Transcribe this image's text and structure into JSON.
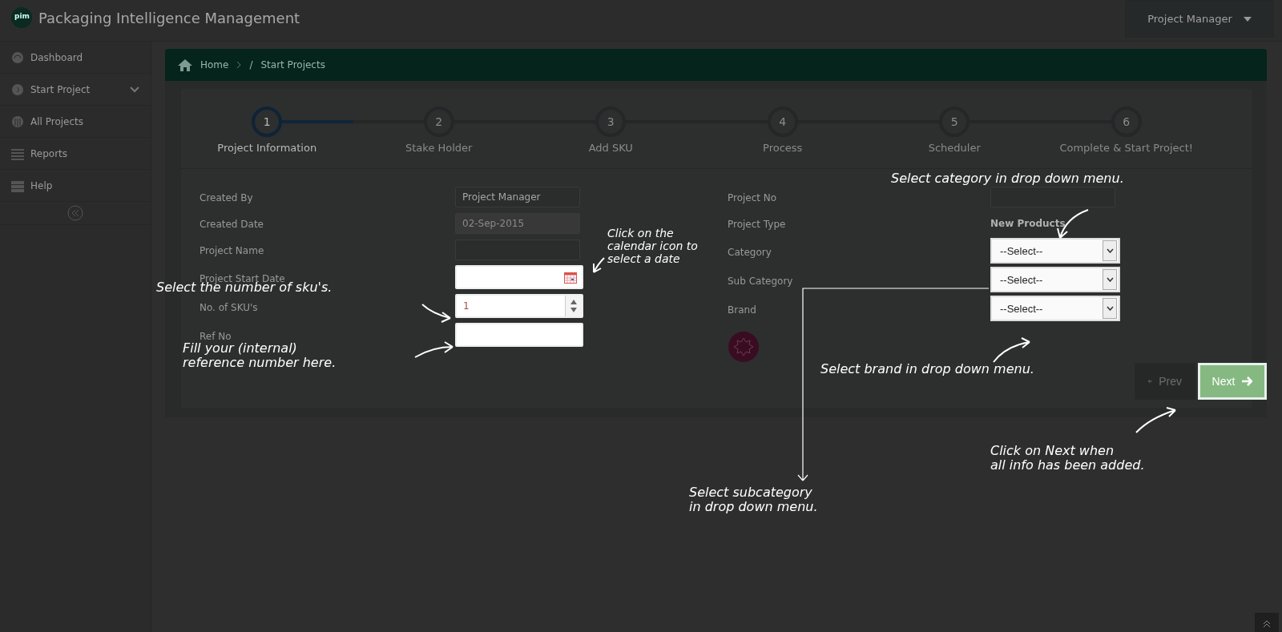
{
  "header": {
    "logo_text": "pim",
    "title": "Packaging Intelligence Management",
    "user_menu": "Project Manager"
  },
  "sidebar": {
    "items": [
      {
        "label": "Dashboard",
        "kind": "gauge",
        "expandable": false
      },
      {
        "label": "Start Project",
        "kind": "play",
        "expandable": true
      },
      {
        "label": "All Projects",
        "kind": "globe",
        "expandable": false
      },
      {
        "label": "Reports",
        "kind": "list",
        "expandable": false
      },
      {
        "label": "Help",
        "kind": "stack",
        "expandable": false
      }
    ]
  },
  "breadcrumb": {
    "items": [
      "Home",
      "Start Projects"
    ],
    "separator": "/"
  },
  "steps": [
    {
      "number": "1",
      "label": "Project Information",
      "selected": true
    },
    {
      "number": "2",
      "label": "Stake Holder",
      "selected": false
    },
    {
      "number": "3",
      "label": "Add SKU",
      "selected": false
    },
    {
      "number": "4",
      "label": "Process",
      "selected": false
    },
    {
      "number": "5",
      "label": "Scheduler",
      "selected": false
    },
    {
      "number": "6",
      "label": "Complete & Start Project!",
      "selected": false
    }
  ],
  "form": {
    "left": [
      {
        "label": "Created By",
        "kind": "text",
        "value": "Project Manager",
        "disabled": false,
        "highlighted": false
      },
      {
        "label": "Created Date",
        "kind": "text",
        "value": "02-Sep-2015",
        "disabled": true,
        "highlighted": false
      },
      {
        "label": "Project Name",
        "kind": "text",
        "disabled": false,
        "highlighted": false
      },
      {
        "label": "Project Start Date",
        "kind": "date",
        "disabled": false,
        "highlighted": true
      },
      {
        "label": "No. of SKU's",
        "kind": "number",
        "value": "1",
        "disabled": false,
        "highlighted": true
      },
      {
        "label": "Ref No",
        "kind": "text",
        "disabled": false,
        "highlighted": true
      }
    ],
    "right": [
      {
        "label": "Project No",
        "kind": "text",
        "highlighted": false
      },
      {
        "label": "Project Type",
        "kind": "static",
        "value": "New Products",
        "highlighted": false
      },
      {
        "label": "Category",
        "kind": "select",
        "value": "--Select--",
        "highlighted": true
      },
      {
        "label": "Sub Category",
        "kind": "select",
        "value": "--Select--",
        "highlighted": true
      },
      {
        "label": "Brand",
        "kind": "select",
        "value": "--Select--",
        "highlighted": true
      }
    ]
  },
  "buttons": [
    {
      "label": "Prev",
      "kind": "prev",
      "highlighted": false
    },
    {
      "label": "Next",
      "kind": "next",
      "highlighted": true
    }
  ],
  "annotations": [
    {
      "text": "Click on the calendar icon to select a date"
    },
    {
      "text": "Select the number of sku's."
    },
    {
      "text": "Fill your (internal)\nreference number here."
    },
    {
      "text": "Select category in drop down menu."
    },
    {
      "text": "Select brand in drop down menu."
    },
    {
      "text": "Select subcategory\nin drop down menu."
    },
    {
      "text": "Click on Next when\nall info has been added."
    }
  ]
}
